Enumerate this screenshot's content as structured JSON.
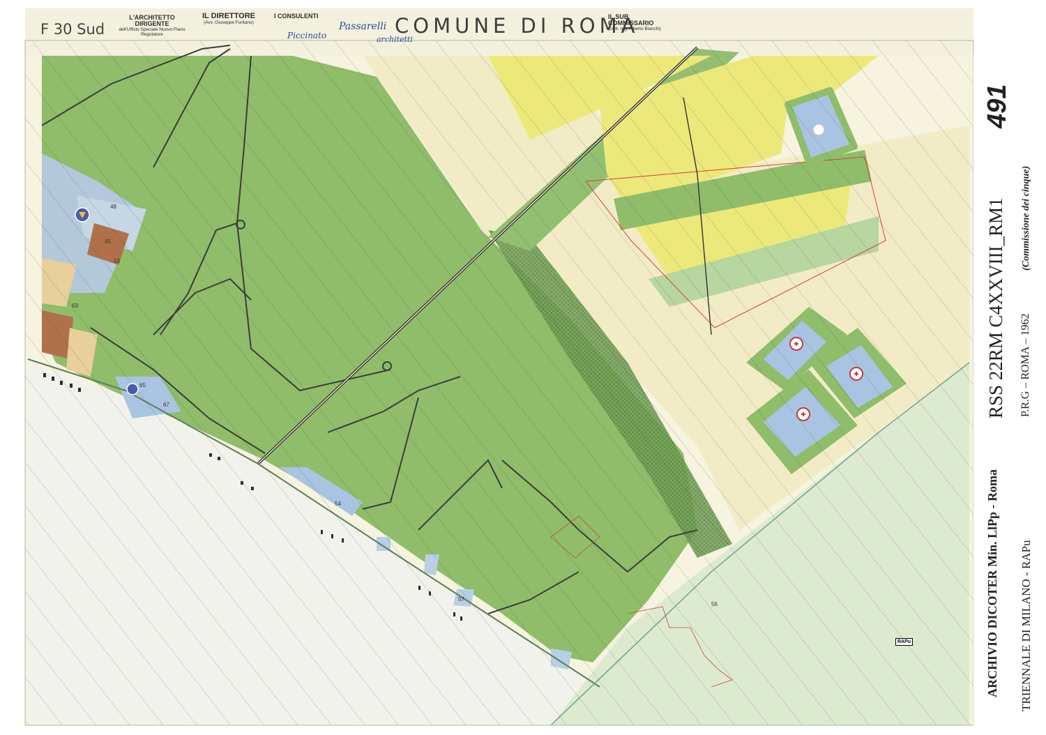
{
  "header": {
    "sheet_id": "F 30 Sud",
    "title": "COMUNE DI ROMA",
    "stamps": {
      "architect": {
        "title": "L'ARCHITETTO DIRIGENTE",
        "subtitle": "dell'Ufficio Speciale Nuovo Piano Regolatore"
      },
      "director": {
        "title": "IL DIRETTORE",
        "subtitle": "(Avv. Giuseppe Furitano)"
      },
      "consultants": {
        "title": "I CONSULENTI"
      },
      "subcommissioner": {
        "title": "IL SUB COMMISSARIO",
        "subtitle": "(Dott. Ing. Alberto Bianchi)"
      }
    },
    "handwritten": {
      "note_1": "Piccinato",
      "note_2": "Passarelli",
      "note_3": "architetti"
    }
  },
  "side_panel": {
    "sheet_number": "491",
    "archive_code": "RSS 22RM C4XXVIII_RM1",
    "archive_name": "ARCHIVIO DICOTER Min. LlPp - Roma",
    "plan_info": "P.R.G – ROMA – 1962",
    "commission_note": "(Commissione dei cinque)",
    "institute": "TRIENNALE DI MILANO - RAPu"
  },
  "map": {
    "stamp_tag": "RAPu",
    "zone_labels": [
      "48",
      "45",
      "53",
      "63",
      "65",
      "67",
      "57",
      "54",
      "56"
    ],
    "colors": {
      "paper": "#f6f3de",
      "park_green": "#8fbd6a",
      "light_green": "#b7d6a0",
      "yellow_zone": "#ece97a",
      "blue_zone": "#a9c4e3",
      "brown_zone": "#b0714a",
      "tan_zone": "#e8cf9c",
      "sea": "#eef0ea",
      "road": "#3c3c3c",
      "red_boundary": "#d3413a"
    },
    "symbols": [
      "civil-protection-emblem",
      "red-cross-emblem"
    ]
  }
}
